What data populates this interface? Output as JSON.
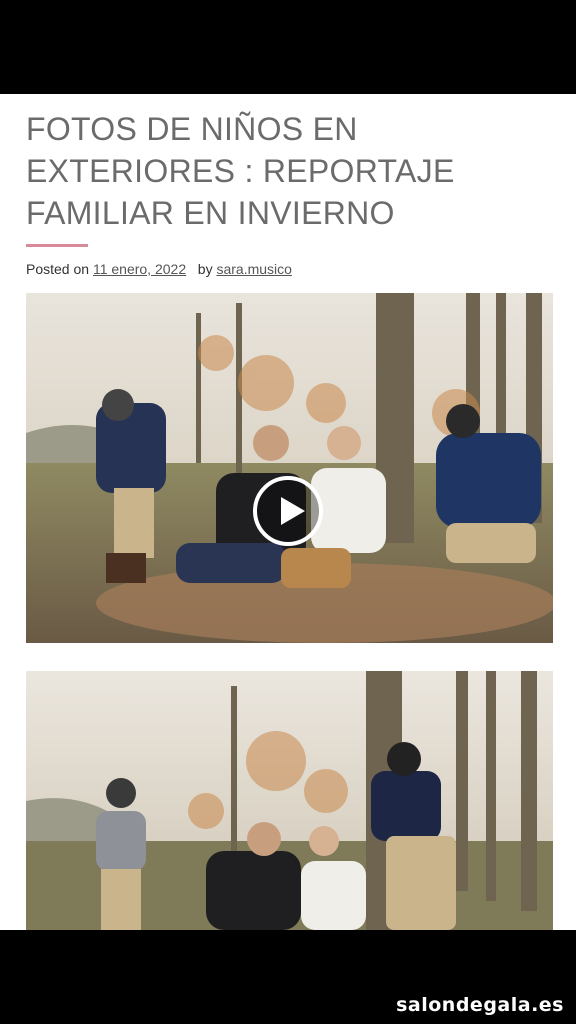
{
  "article": {
    "title": "FOTOS DE NIÑOS EN EXTERIORES : REPORTAJE FAMILIAR EN INVIERNO",
    "meta": {
      "posted_on_label": "Posted on",
      "date": "11 enero, 2022",
      "by_label": "by",
      "author": "sara.musico"
    },
    "accent_color": "#d98a9a"
  },
  "video": {
    "play_icon": "play-icon"
  },
  "watermark": "salondegala.es"
}
